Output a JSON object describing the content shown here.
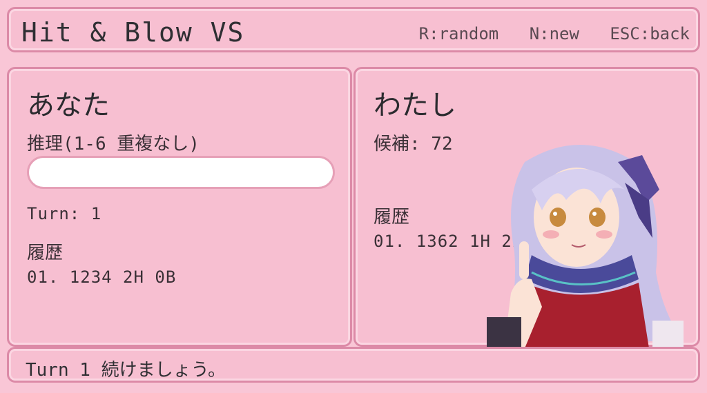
{
  "header": {
    "title": "Hit & Blow VS",
    "shortcuts": [
      "R:random",
      "N:new",
      "ESC:back"
    ]
  },
  "player": {
    "name": "あなた",
    "input_label": "推理(1-6 重複なし)",
    "input_value": "",
    "turn": "Turn: 1",
    "history_label": "履歴",
    "history": [
      "01. 1234  2H 0B"
    ]
  },
  "cpu": {
    "name": "わたし",
    "candidates": "候補: 72",
    "history_label": "履歴",
    "history": [
      "01. 1362  1H 2B"
    ]
  },
  "footer": {
    "message": "Turn 1 続けましょう。"
  },
  "colors": {
    "background": "#f9c6d6",
    "panel_border": "#dc8aa7"
  }
}
